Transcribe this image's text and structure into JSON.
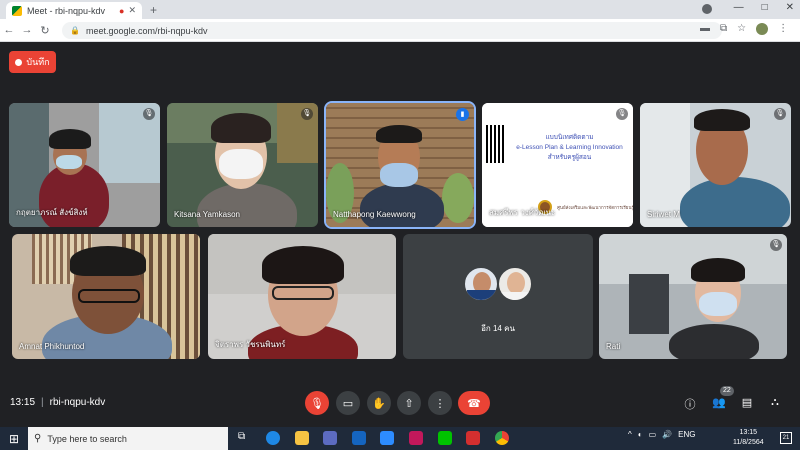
{
  "browser": {
    "tab_title": "Meet - rbi-nqpu-kdv",
    "new_tab": "+",
    "url": "meet.google.com/rbi-nqpu-kdv",
    "window_controls": [
      "—",
      "□",
      "✕"
    ]
  },
  "record_label": "บันทึก",
  "tiles": [
    {
      "name": "กฤตยาภรณ์ สังข์สิงห์",
      "muted": true
    },
    {
      "name": "Kitsana Yamkason",
      "muted": true
    },
    {
      "name": "Natthapong Kaewwong",
      "speaking": true
    },
    {
      "name": "สมศรีพร วงศ์วัฒนะ",
      "muted": true
    },
    {
      "name": "Siriwet M",
      "muted": true
    },
    {
      "name": "Amnat Phikhuntod"
    },
    {
      "name": "จิตราพร วัชรนพินทร์"
    },
    {
      "name": "Rati",
      "muted": true
    }
  ],
  "slide": {
    "line1": "แบบนิเทศติดตาม",
    "line2": "e-Lesson Plan & Learning Innovation",
    "line3": "สำหรับครูผู้สอน",
    "footer": "ศูนย์ส่งเสริมและพัฒนาการจัดการเรียนรู้"
  },
  "others_label": "อีก 14 คน",
  "meeting": {
    "time": "13:15",
    "code": "rbi-nqpu-kdv"
  },
  "participants_count": "22",
  "taskbar": {
    "search_placeholder": "Type here to search",
    "tray_lang": "ENG",
    "time": "13:15",
    "date": "11/8/2564",
    "notification_count": "21"
  },
  "colors": {
    "meet_bg": "#202124",
    "tile_bg": "#3c4043",
    "red": "#ea4335",
    "active_blue": "#8ab4f8"
  }
}
